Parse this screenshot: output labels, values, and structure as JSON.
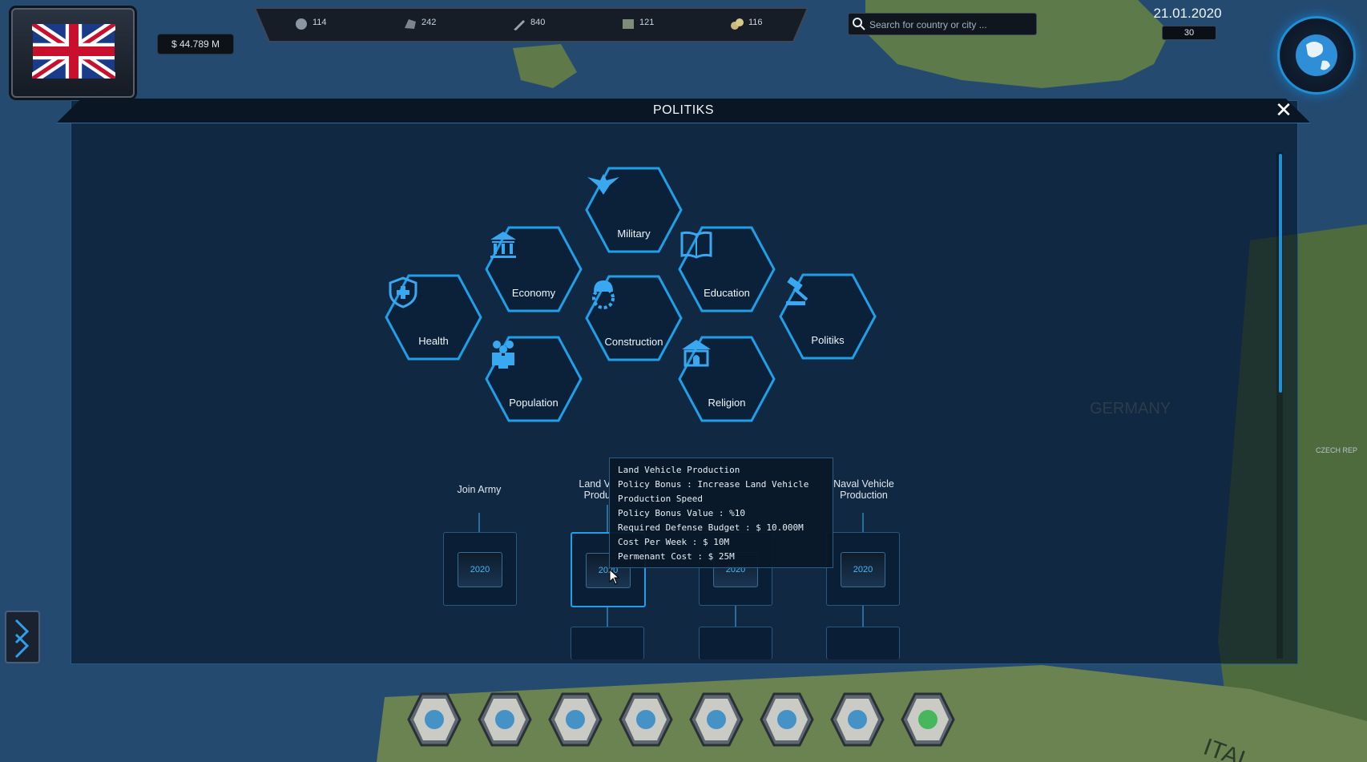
{
  "hud": {
    "money": "$ 44.789 M",
    "resources": [
      {
        "name": "iron-ore-icon",
        "value": "114"
      },
      {
        "name": "coal-icon",
        "value": "242"
      },
      {
        "name": "oil-icon",
        "value": "840"
      },
      {
        "name": "crate-icon",
        "value": "121"
      },
      {
        "name": "gold-icon",
        "value": "116"
      }
    ],
    "search_placeholder": "Search for country or city ...",
    "date": "21.01.2020",
    "day_counter": "30"
  },
  "panel": {
    "title": "POLITIKS",
    "categories": [
      {
        "key": "military",
        "label": "Military",
        "icon": "eagle-icon"
      },
      {
        "key": "economy",
        "label": "Economy",
        "icon": "bank-icon"
      },
      {
        "key": "education",
        "label": "Education",
        "icon": "book-icon"
      },
      {
        "key": "health",
        "label": "Health",
        "icon": "shield-cross-icon"
      },
      {
        "key": "construction",
        "label": "Construction",
        "icon": "hardhat-gear-icon"
      },
      {
        "key": "politiks",
        "label": "Politiks",
        "icon": "gavel-icon"
      },
      {
        "key": "population",
        "label": "Population",
        "icon": "people-icon"
      },
      {
        "key": "religion",
        "label": "Religion",
        "icon": "temple-icon"
      }
    ],
    "policies": [
      {
        "title": "Join Army",
        "card": "2020"
      },
      {
        "title": "Land V\nProdu",
        "card": "2020"
      },
      {
        "title": "",
        "card": "2020"
      },
      {
        "title": "Naval Vehicle\nProduction",
        "card": "2020"
      }
    ]
  },
  "tooltip": {
    "lines": [
      "Land Vehicle Production",
      "Policy Bonus : Increase Land Vehicle",
      "Production Speed",
      "Policy Bonus Value : %10",
      "Required Defense Budget :  $ 10.000M",
      "Cost Per Week :  $ 10M",
      "Permenant Cost :  $ 25M"
    ]
  },
  "map_labels": {
    "germany": "GERMANY",
    "italy": "ITAL",
    "czech": "CZECH REP"
  },
  "bottom_bar": [
    {
      "name": "economy-chart-icon"
    },
    {
      "name": "laboratory-flask-icon"
    },
    {
      "name": "factory-icon"
    },
    {
      "name": "world-globe-icon"
    },
    {
      "name": "military-tower-icon"
    },
    {
      "name": "scroll-document-icon"
    },
    {
      "name": "hand-money-icon"
    },
    {
      "name": "pie-chart-icon"
    }
  ],
  "colors": {
    "accent": "#1f9fe8",
    "panel_border": "#1f5b86",
    "sea": "#1b3a5a"
  }
}
